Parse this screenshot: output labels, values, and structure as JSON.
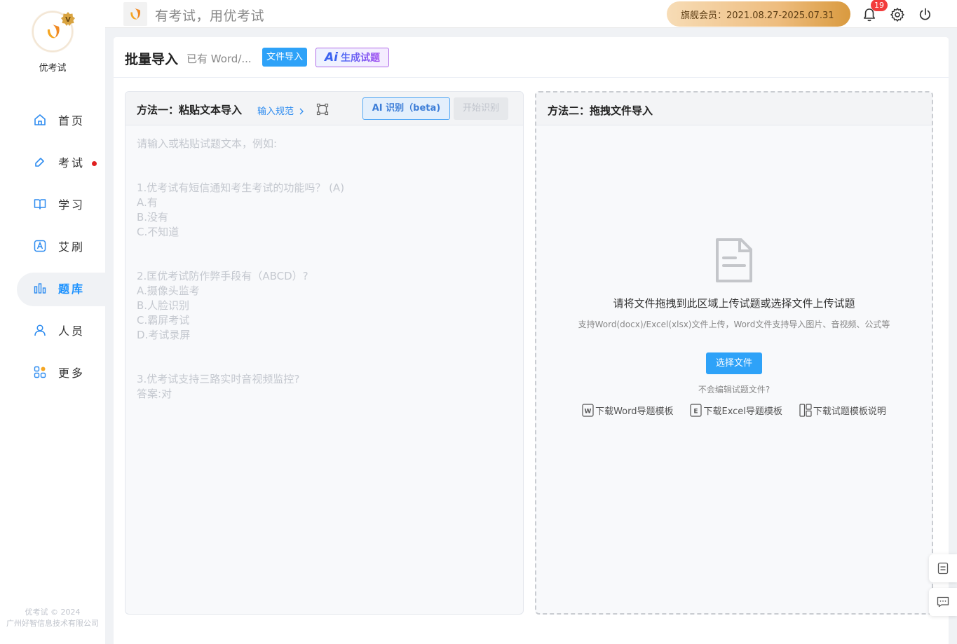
{
  "brand": {
    "name": "优考试",
    "copyright_line1": "优考试 © 2024",
    "copyright_line2": "广州好智信息技术有限公司"
  },
  "sidebar": {
    "items": [
      {
        "label": "首页",
        "icon": "home-icon"
      },
      {
        "label": "考试",
        "icon": "exam-icon",
        "dot": true
      },
      {
        "label": "学习",
        "icon": "book-icon"
      },
      {
        "label": "艾刷",
        "icon": "a-letter-icon"
      },
      {
        "label": "题库",
        "icon": "bar-chart-icon",
        "active": true
      },
      {
        "label": "人员",
        "icon": "user-icon"
      },
      {
        "label": "更多",
        "icon": "more-grid-icon"
      }
    ]
  },
  "header": {
    "slogan": "有考试，用优考试",
    "membership": "旗舰会员：2021.08.27-2025.07.31",
    "notification_count": "19"
  },
  "page": {
    "title": "批量导入",
    "subtitle": "已有 Word/...",
    "file_import_button": "文件导入",
    "ai_generate_button": "生成试题",
    "ai_mark": "Ai"
  },
  "left_panel": {
    "title": "方法一：粘贴文本导入",
    "spec_link": "输入规范",
    "ai_recognize_button": "AI 识别（beta)",
    "start_button": "开始识别",
    "placeholder_lines": [
      "请输入或粘贴试题文本，例如:",
      "",
      "",
      "1.优考试有短信通知考生考试的功能吗？ (A)",
      "A.有",
      "B.没有",
      "C.不知道",
      "",
      "",
      "2.匡优考试防作弊手段有（ABCD）?",
      "A.摄像头监考",
      "B.人脸识别",
      "C.霸屏考试",
      "D.考试录屏",
      "",
      "",
      "3.优考试支持三路实时音视频监控?",
      "答案:对"
    ]
  },
  "right_panel": {
    "title": "方法二：拖拽文件导入",
    "drop_main": "请将文件拖拽到此区域上传试题或选择文件上传试题",
    "drop_sub": "支持Word(docx)/Excel(xlsx)文件上传，Word文件支持导入图片、音视频、公式等",
    "choose_button": "选择文件",
    "no_edit_text": "不会编辑试题文件?",
    "downloads": [
      {
        "label": "下载Word导题模板",
        "icon": "word-file-icon"
      },
      {
        "label": "下载Excel导题模板",
        "icon": "excel-file-icon"
      },
      {
        "label": "下载试题模板说明",
        "icon": "layout-icon"
      }
    ]
  },
  "colors": {
    "primary": "#2ea2f8",
    "active_nav": "#1890ff",
    "badge": "#f23c3c"
  }
}
